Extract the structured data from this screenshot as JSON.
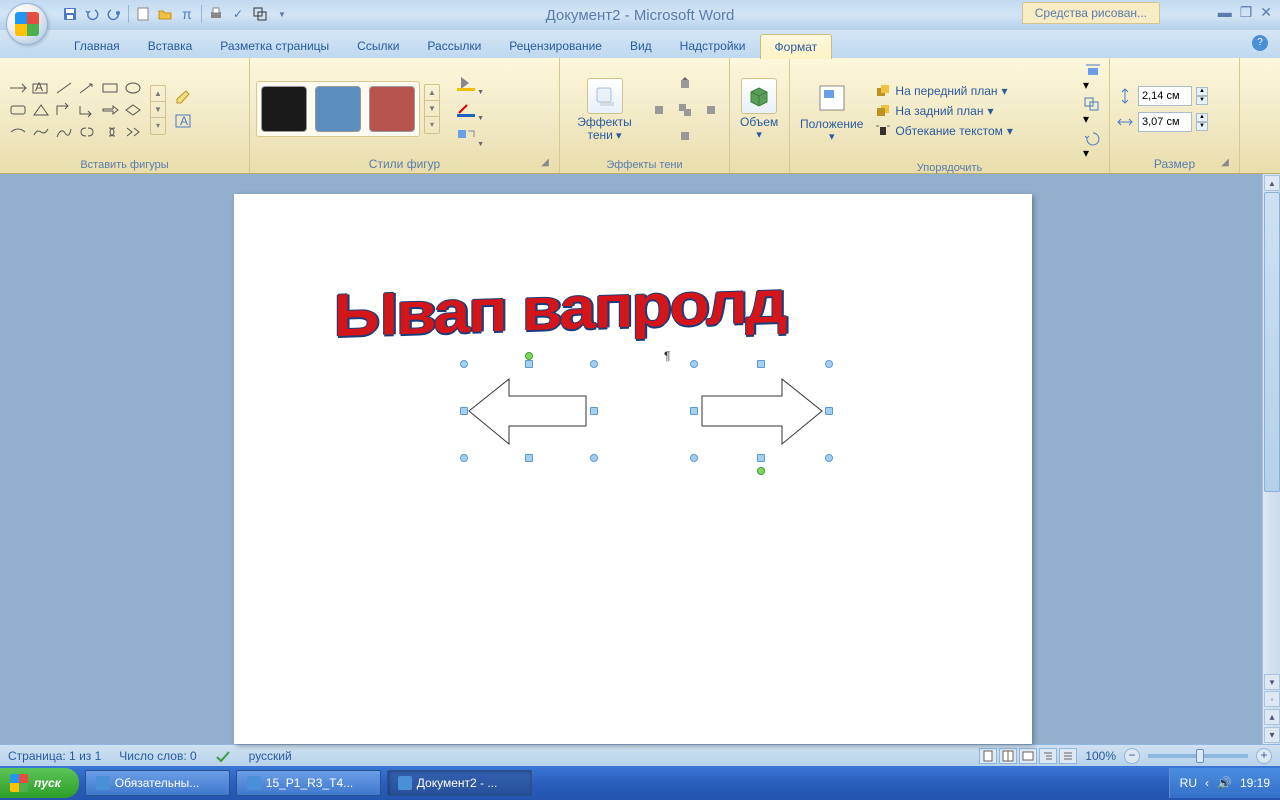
{
  "title": "Документ2 - Microsoft Word",
  "tool_tab": "Средства рисован...",
  "tabs": {
    "home": "Главная",
    "insert": "Вставка",
    "layout": "Разметка страницы",
    "refs": "Ссылки",
    "mail": "Рассылки",
    "review": "Рецензирование",
    "view": "Вид",
    "addins": "Надстройки",
    "format": "Формат"
  },
  "groups": {
    "insert_shapes": "Вставить фигуры",
    "shape_styles": "Стили фигур",
    "shadow_effects": "Эффекты тени",
    "threed": "",
    "arrange": "Упорядочить",
    "size": "Размер"
  },
  "buttons": {
    "shadow": "Эффекты\nтени",
    "volume": "Объем",
    "position": "Положение",
    "bring_front": "На передний план",
    "send_back": "На задний план",
    "text_wrap": "Обтекание текстом"
  },
  "size": {
    "height": "2,14 см",
    "width": "3,07 см"
  },
  "status": {
    "page": "Страница: 1 из 1",
    "words": "Число слов: 0",
    "lang": "русский",
    "zoom": "100%"
  },
  "wordart_text": "Ывап вапролд",
  "taskbar": {
    "start": "пуск",
    "items": [
      "Обязательны...",
      "15_P1_R3_Т4...",
      "Документ2 - ..."
    ],
    "lang": "RU",
    "time": "19:19"
  }
}
